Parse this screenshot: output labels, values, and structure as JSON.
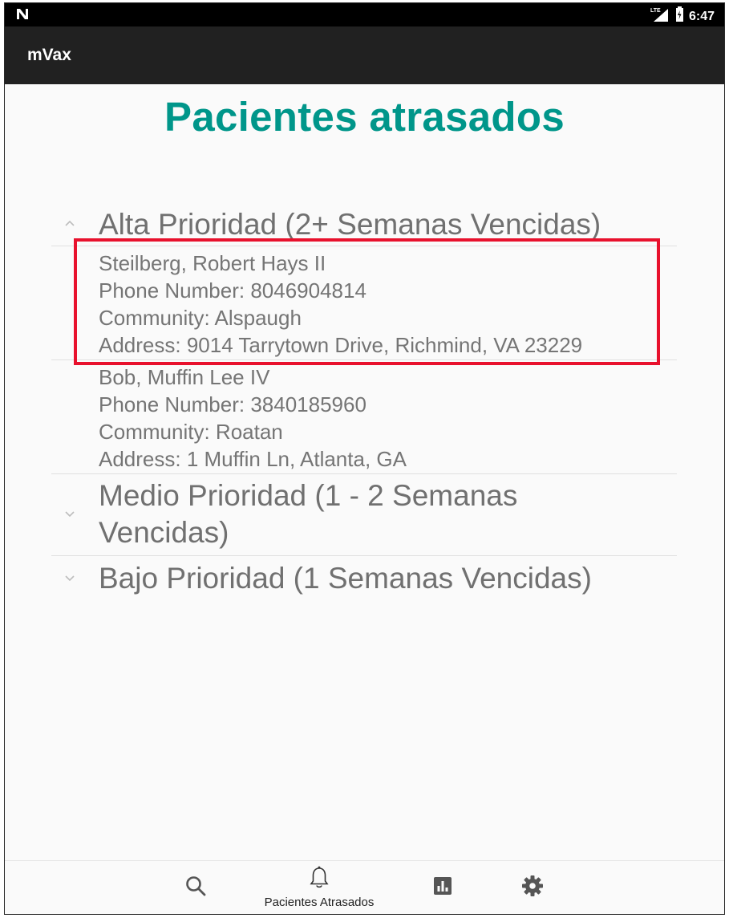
{
  "status_bar": {
    "time": "6:47",
    "network": "LTE"
  },
  "app_bar": {
    "title": "mVax"
  },
  "page": {
    "title": "Pacientes atrasados"
  },
  "groups": [
    {
      "label": "Alta Prioridad (2+ Semanas Vencidas)",
      "expanded": true,
      "patients": [
        {
          "name": "Steilberg, Robert Hays II",
          "phone": "Phone Number: 8046904814",
          "community": "Community: Alspaugh",
          "address": "Address: 9014 Tarrytown Drive, Richmind, VA 23229"
        },
        {
          "name": "Bob, Muffin Lee IV",
          "phone": "Phone Number: 3840185960",
          "community": "Community: Roatan",
          "address": "Address: 1 Muffin Ln, Atlanta, GA"
        }
      ]
    },
    {
      "label": "Medio Prioridad (1 - 2 Semanas Vencidas)",
      "expanded": false
    },
    {
      "label": "Bajo Prioridad (1 Semanas Vencidas)",
      "expanded": false
    }
  ],
  "bottom_nav": {
    "items": [
      {
        "icon": "search-icon",
        "label": ""
      },
      {
        "icon": "bell-icon",
        "label": "Pacientes Atrasados"
      },
      {
        "icon": "bar-chart-icon",
        "label": ""
      },
      {
        "icon": "gear-icon",
        "label": ""
      }
    ]
  },
  "colors": {
    "accent": "#00968a",
    "highlight": "#e8112d",
    "app_bar": "#212121"
  }
}
